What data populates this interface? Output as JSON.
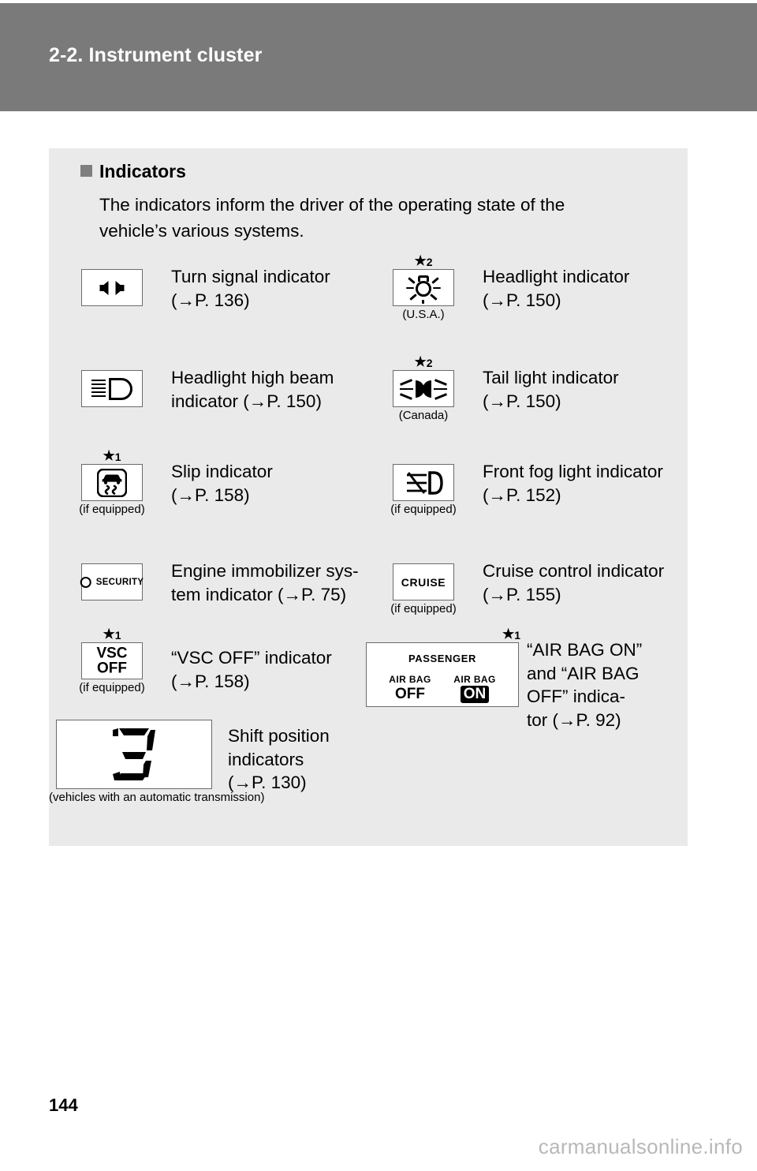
{
  "header": {
    "title": "2-2. Instrument cluster"
  },
  "section": {
    "heading": "Indicators",
    "body_line1": "The indicators inform the driver of the operating state of the",
    "body_line2": "vehicle’s various systems."
  },
  "indicators": [
    {
      "icon": "turn-signal-icon",
      "star": "",
      "star_num": "",
      "sub_caption": "",
      "label_line1": "Turn signal indicator",
      "label_line2": "(→P. 136)",
      "page_ref": "P. 136"
    },
    {
      "icon": "headlight-indicator-icon",
      "star": "★",
      "star_num": "2",
      "sub_caption": "(U.S.A.)",
      "label_line1": "Headlight indicator",
      "label_line2": "(→P. 150)",
      "page_ref": "P. 150"
    },
    {
      "icon": "high-beam-icon",
      "star": "",
      "star_num": "",
      "sub_caption": "",
      "label_line1": "Headlight high beam",
      "label_line2": "indicator (→P. 150)",
      "page_ref": "P. 150"
    },
    {
      "icon": "tail-light-icon",
      "star": "★",
      "star_num": "2",
      "sub_caption": "(Canada)",
      "label_line1": "Tail light indicator",
      "label_line2": "(→P. 150)",
      "page_ref": "P. 150"
    },
    {
      "icon": "slip-indicator-icon",
      "star": "★",
      "star_num": "1",
      "sub_caption": "(if equipped)",
      "label_line1": "Slip indicator",
      "label_line2": "(→P. 158)",
      "page_ref": "P. 158"
    },
    {
      "icon": "front-fog-light-icon",
      "star": "",
      "star_num": "",
      "sub_caption": "(if equipped)",
      "label_line1": "Front fog light indicator",
      "label_line2": "(→P. 152)",
      "page_ref": "P. 152"
    },
    {
      "icon": "security-indicator-icon",
      "star": "",
      "star_num": "",
      "sub_caption": "",
      "icon_text": "SECURITY",
      "label_line1": "Engine immobilizer sys-",
      "label_line2": "tem indicator (→P. 75)",
      "page_ref": "P. 75"
    },
    {
      "icon": "cruise-control-icon",
      "star": "",
      "star_num": "",
      "sub_caption": "(if equipped)",
      "icon_text": "CRUISE",
      "label_line1": "Cruise control indicator",
      "label_line2": "(→P. 155)",
      "page_ref": "P. 155"
    },
    {
      "icon": "vsc-off-icon",
      "star": "★",
      "star_num": "1",
      "sub_caption": "(if equipped)",
      "icon_text_line1": "VSC",
      "icon_text_line2": "OFF",
      "label_line1": "“VSC OFF” indicator",
      "label_line2": "(→P. 158)",
      "page_ref": "P. 158"
    },
    {
      "icon": "air-bag-on-off-icon",
      "star": "★",
      "star_num": "1",
      "sub_caption": "",
      "passenger_label": "PASSENGER",
      "airbag_left_small": "AIR BAG",
      "airbag_left_big": "OFF",
      "airbag_right_small": "AIR BAG",
      "airbag_right_big": "ON",
      "label_line1": "“AIR BAG ON”",
      "label_line2": "and “AIR BAG",
      "label_line3": "OFF” indica-",
      "label_line4": "tor (→P. 92)",
      "page_ref": "P. 92"
    },
    {
      "icon": "shift-position-icon",
      "star": "",
      "star_num": "",
      "sub_caption": "(vehicles with an automatic transmission)",
      "icon_digit": "3",
      "label_line1": "Shift position",
      "label_line2": "indicators",
      "label_line3": "(→P. 130)",
      "page_ref": "P. 130"
    }
  ],
  "footer": {
    "page_number": "144",
    "watermark": "carmanualsonline.info"
  },
  "colors": {
    "header_band": "#7a7a7a",
    "panel": "#eaeaea",
    "bullet": "#7f7f7f",
    "icon_border": "#6b6b6b",
    "watermark": "#b8b8b8"
  }
}
